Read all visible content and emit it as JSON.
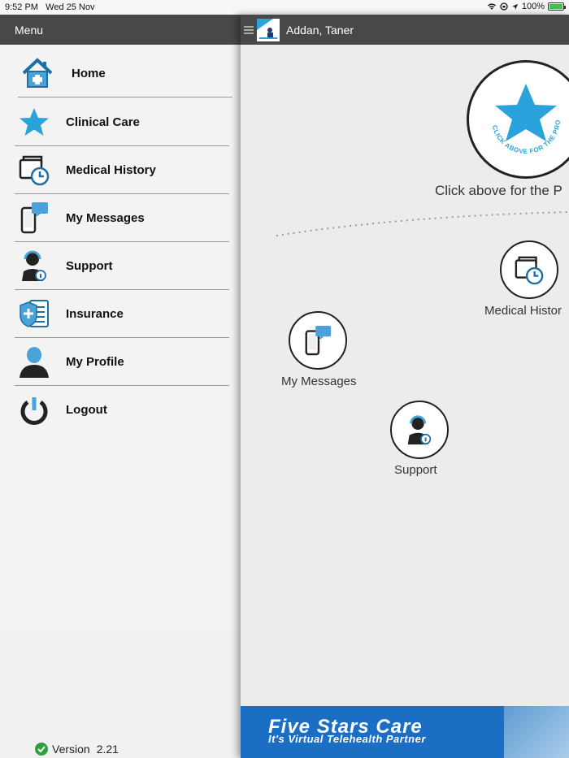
{
  "status": {
    "time": "9:52 PM",
    "date": "Wed 25 Nov",
    "battery": "100%",
    "battery_level": 1.0
  },
  "sidebar": {
    "title": "Menu",
    "items": [
      {
        "label": "Home",
        "icon": "home-icon"
      },
      {
        "label": "Clinical Care",
        "icon": "star-icon"
      },
      {
        "label": "Medical History",
        "icon": "medical-history-icon"
      },
      {
        "label": "My Messages",
        "icon": "messages-icon"
      },
      {
        "label": "Support",
        "icon": "support-icon"
      },
      {
        "label": "Insurance",
        "icon": "insurance-icon"
      },
      {
        "label": "My Profile",
        "icon": "profile-icon"
      },
      {
        "label": "Logout",
        "icon": "logout-icon"
      }
    ],
    "version_label": "Version",
    "version_number": "2.21"
  },
  "main": {
    "patient_name": "Addan, Taner",
    "provider_caption": "Click above for the P",
    "provider_ring_text": "CLICK ABOVE FOR THE PROVIDER",
    "nodes": {
      "medical_history": "Medical Histor",
      "my_messages": "My Messages",
      "support": "Support"
    },
    "banner": {
      "title": "Five Stars Care",
      "subtitle": "It's Virtual Telehealth Partner"
    }
  },
  "colors": {
    "accent": "#2aa3dc",
    "topbar": "#484848",
    "banner": "#1a6fc4"
  }
}
